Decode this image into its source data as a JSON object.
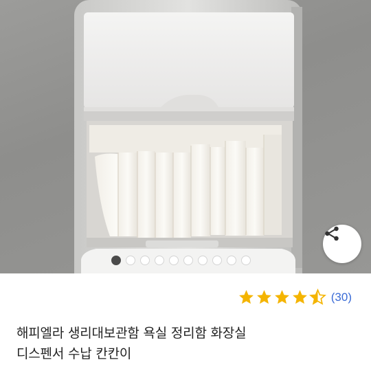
{
  "product": {
    "title_line1": "해피엘라 생리대보관함 욕실 정리함 화장실",
    "title_line2": "디스펜서 수납 칸칸이"
  },
  "rating": {
    "stars": 4.5,
    "max_stars": 5,
    "review_count": "(30)",
    "star_color": "#f4b400",
    "count_color": "#3a6bd6"
  },
  "gallery": {
    "image_count": 10,
    "active_index": 0
  },
  "icons": {
    "share": "share-icon",
    "star": "star-icon"
  }
}
